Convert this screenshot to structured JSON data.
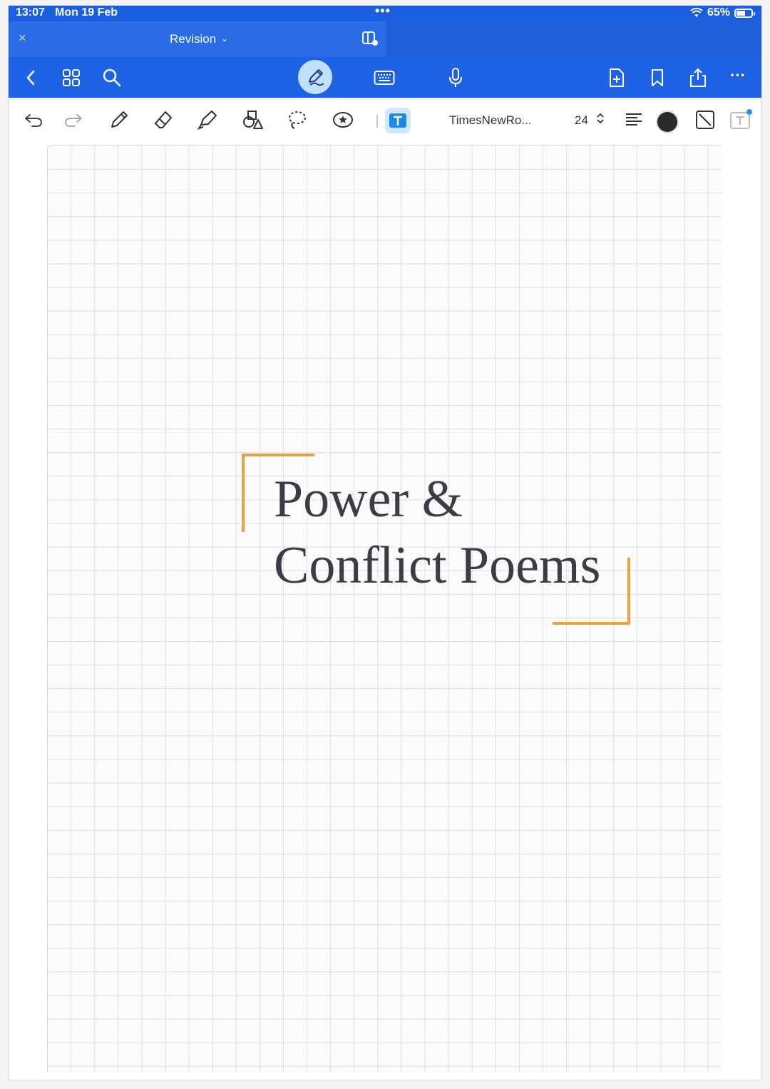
{
  "status_bar": {
    "time": "13:07",
    "date": "Mon 19 Feb",
    "battery_percent": "65%",
    "battery_level": 0.65
  },
  "tab_bar": {
    "close_glyph": "×",
    "tab_title": "Revision",
    "tab_chevron": "⌄"
  },
  "main_toolbar": {
    "icons": [
      "back-icon",
      "grid-icon",
      "search-icon",
      "pen-mode-icon",
      "keyboard-icon",
      "microphone-icon",
      "add-page-icon",
      "bookmark-icon",
      "share-icon",
      "more-icon"
    ],
    "more_glyph": "···"
  },
  "tools_bar": {
    "font_name": "TimesNewRo...",
    "font_size": "24",
    "font_size_arrows": "⌃⌄",
    "text_color": "#2a2a2a"
  },
  "page": {
    "title_line1": "Power &",
    "title_line2": "Conflict Poems",
    "bracket_color": "#e8a040"
  },
  "colors": {
    "accent_blue": "#1e63e6",
    "active_tool_bg": "#cfe7ff",
    "grid_line": "#dedede"
  }
}
